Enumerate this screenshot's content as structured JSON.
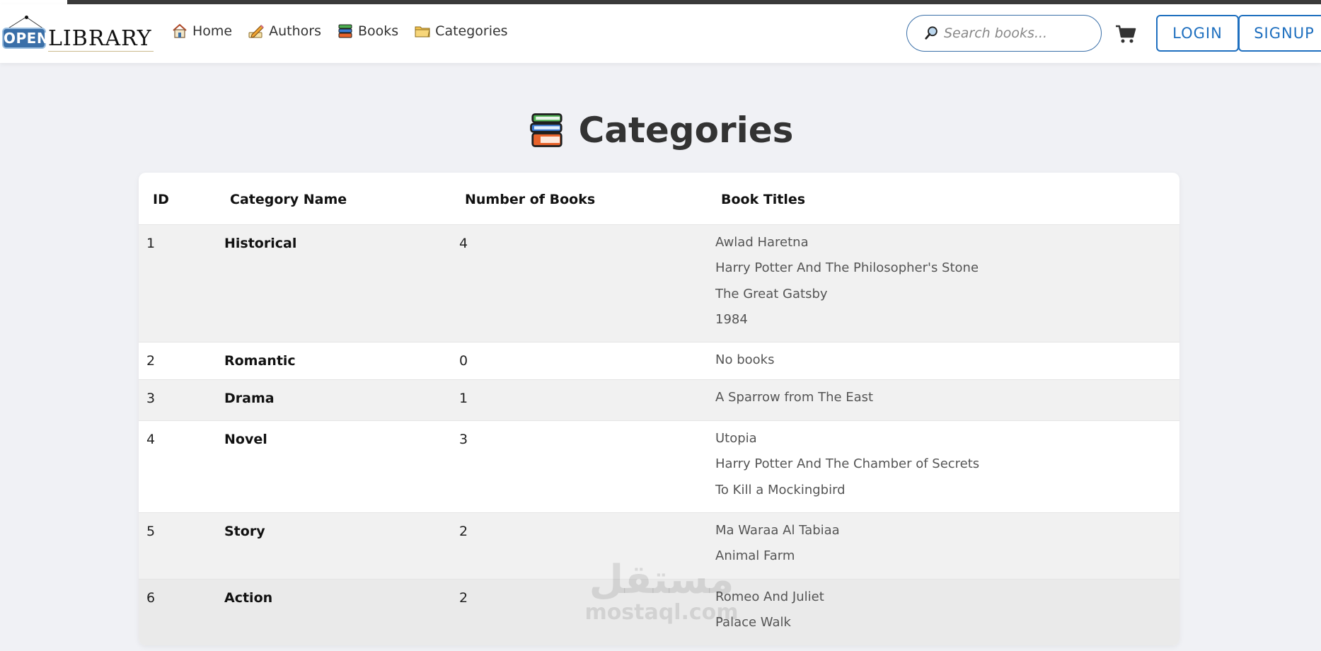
{
  "brand": {
    "open_label": "OPEN",
    "library_label": "LIBRARY"
  },
  "nav": {
    "items": [
      {
        "label": "Home",
        "icon": "house-icon"
      },
      {
        "label": "Authors",
        "icon": "pencil-writing-icon"
      },
      {
        "label": "Books",
        "icon": "books-stack-icon"
      },
      {
        "label": "Categories",
        "icon": "folder-icon"
      }
    ]
  },
  "search": {
    "placeholder": "Search books...",
    "icon": "magnifier-icon"
  },
  "cart": {
    "icon": "cart-icon"
  },
  "auth": {
    "login_label": "LOGIN",
    "signup_label": "SIGNUP"
  },
  "colors": {
    "accent": "#1e6fbf",
    "page_bg": "#f0f1f5"
  },
  "page": {
    "title": "Categories",
    "title_icon": "books-stack-icon"
  },
  "table": {
    "headers": {
      "id": "ID",
      "name": "Category Name",
      "count": "Number of Books",
      "titles": "Book Titles"
    },
    "rows": [
      {
        "id": "1",
        "name": "Historical",
        "count": "4",
        "titles": [
          "Awlad Haretna",
          "Harry Potter And The Philosopher's Stone",
          "The Great Gatsby",
          "1984"
        ]
      },
      {
        "id": "2",
        "name": "Romantic",
        "count": "0",
        "titles": [
          "No books"
        ]
      },
      {
        "id": "3",
        "name": "Drama",
        "count": "1",
        "titles": [
          "A Sparrow from The East"
        ]
      },
      {
        "id": "4",
        "name": "Novel",
        "count": "3",
        "titles": [
          "Utopia",
          "Harry Potter And The Chamber of Secrets",
          "To Kill a Mockingbird"
        ]
      },
      {
        "id": "5",
        "name": "Story",
        "count": "2",
        "titles": [
          "Ma Waraa Al Tabiaa",
          "Animal Farm"
        ]
      },
      {
        "id": "6",
        "name": "Action",
        "count": "2",
        "titles": [
          "Romeo And Juliet",
          "Palace Walk"
        ]
      }
    ]
  },
  "watermark": {
    "arabic": "مستقل",
    "latin": "mostaql.com"
  }
}
